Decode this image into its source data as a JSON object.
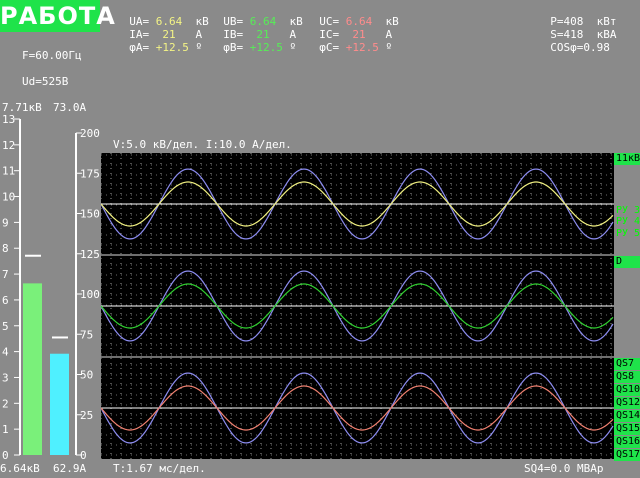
{
  "status": "РАБОТА",
  "phases": {
    "ua": {
      "u_label": "UA=",
      "u_value": "6.64",
      "u_unit": "кВ",
      "i_label": "IA=",
      "i_value": "21",
      "i_unit": "А",
      "phi_label": "φA=",
      "phi_value": "+12.5",
      "phi_unit": "º"
    },
    "ub": {
      "u_label": "UB=",
      "u_value": "6.64",
      "u_unit": "кВ",
      "i_label": "IB=",
      "i_value": "21",
      "i_unit": "А",
      "phi_label": "φB=",
      "phi_value": "+12.5",
      "phi_unit": "º"
    },
    "uc": {
      "u_label": "UC=",
      "u_value": "6.64",
      "u_unit": "кВ",
      "i_label": "IC=",
      "i_value": "21",
      "i_unit": "А",
      "phi_label": "φC=",
      "phi_value": "+12.5",
      "phi_unit": "º"
    }
  },
  "power": {
    "p_label": "P=",
    "p_value": "408",
    "p_unit": "кВт",
    "s_label": "S=",
    "s_value": "418",
    "s_unit": "кВА",
    "cos_label": "COSφ=",
    "cos_value": "0.98"
  },
  "freq": "F=60.00Гц",
  "ud": "Ud=525В",
  "gauges": {
    "voltage": {
      "max_label": "7.71кВ",
      "bottom_label": "6.64кВ",
      "value": 6.64,
      "ref": 7.71,
      "max": 13,
      "ticks": [
        "13",
        "12",
        "11",
        "10",
        "9",
        "8",
        "7",
        "6",
        "5",
        "4",
        "3",
        "2",
        "1",
        "0"
      ],
      "color": "#7af07a"
    },
    "current": {
      "max_label": "73.0А",
      "bottom_label": "62.9А",
      "value": 62.9,
      "ref": 73.0,
      "max": 200,
      "ticks": [
        "200",
        "175",
        "150",
        "125",
        "100",
        "75",
        "50",
        "25",
        "0"
      ],
      "color": "#4ff0ff"
    }
  },
  "scope": {
    "scale_text": "V:5.0 кВ/дел. I:10.0 А/дел.",
    "time_text": "T:1.67 мс/дел.",
    "sq_text": "SQ4=0.0 МВАр",
    "colors": {
      "voltage": "#8c8cf0",
      "phaseA": "#f0f080",
      "phaseB": "#30d030",
      "phaseC": "#f08070"
    },
    "tags": {
      "t1": "11кВ",
      "t2": "РУ 3",
      "t3": "РУ 4",
      "t4": "РУ 5",
      "t5": "D",
      "t6": "QS7",
      "t7": "QS8",
      "t8": "QS10",
      "t9": "QS12",
      "t10": "QS14",
      "t11": "QS15",
      "t12": "QS16",
      "t13": "QS17"
    }
  }
}
